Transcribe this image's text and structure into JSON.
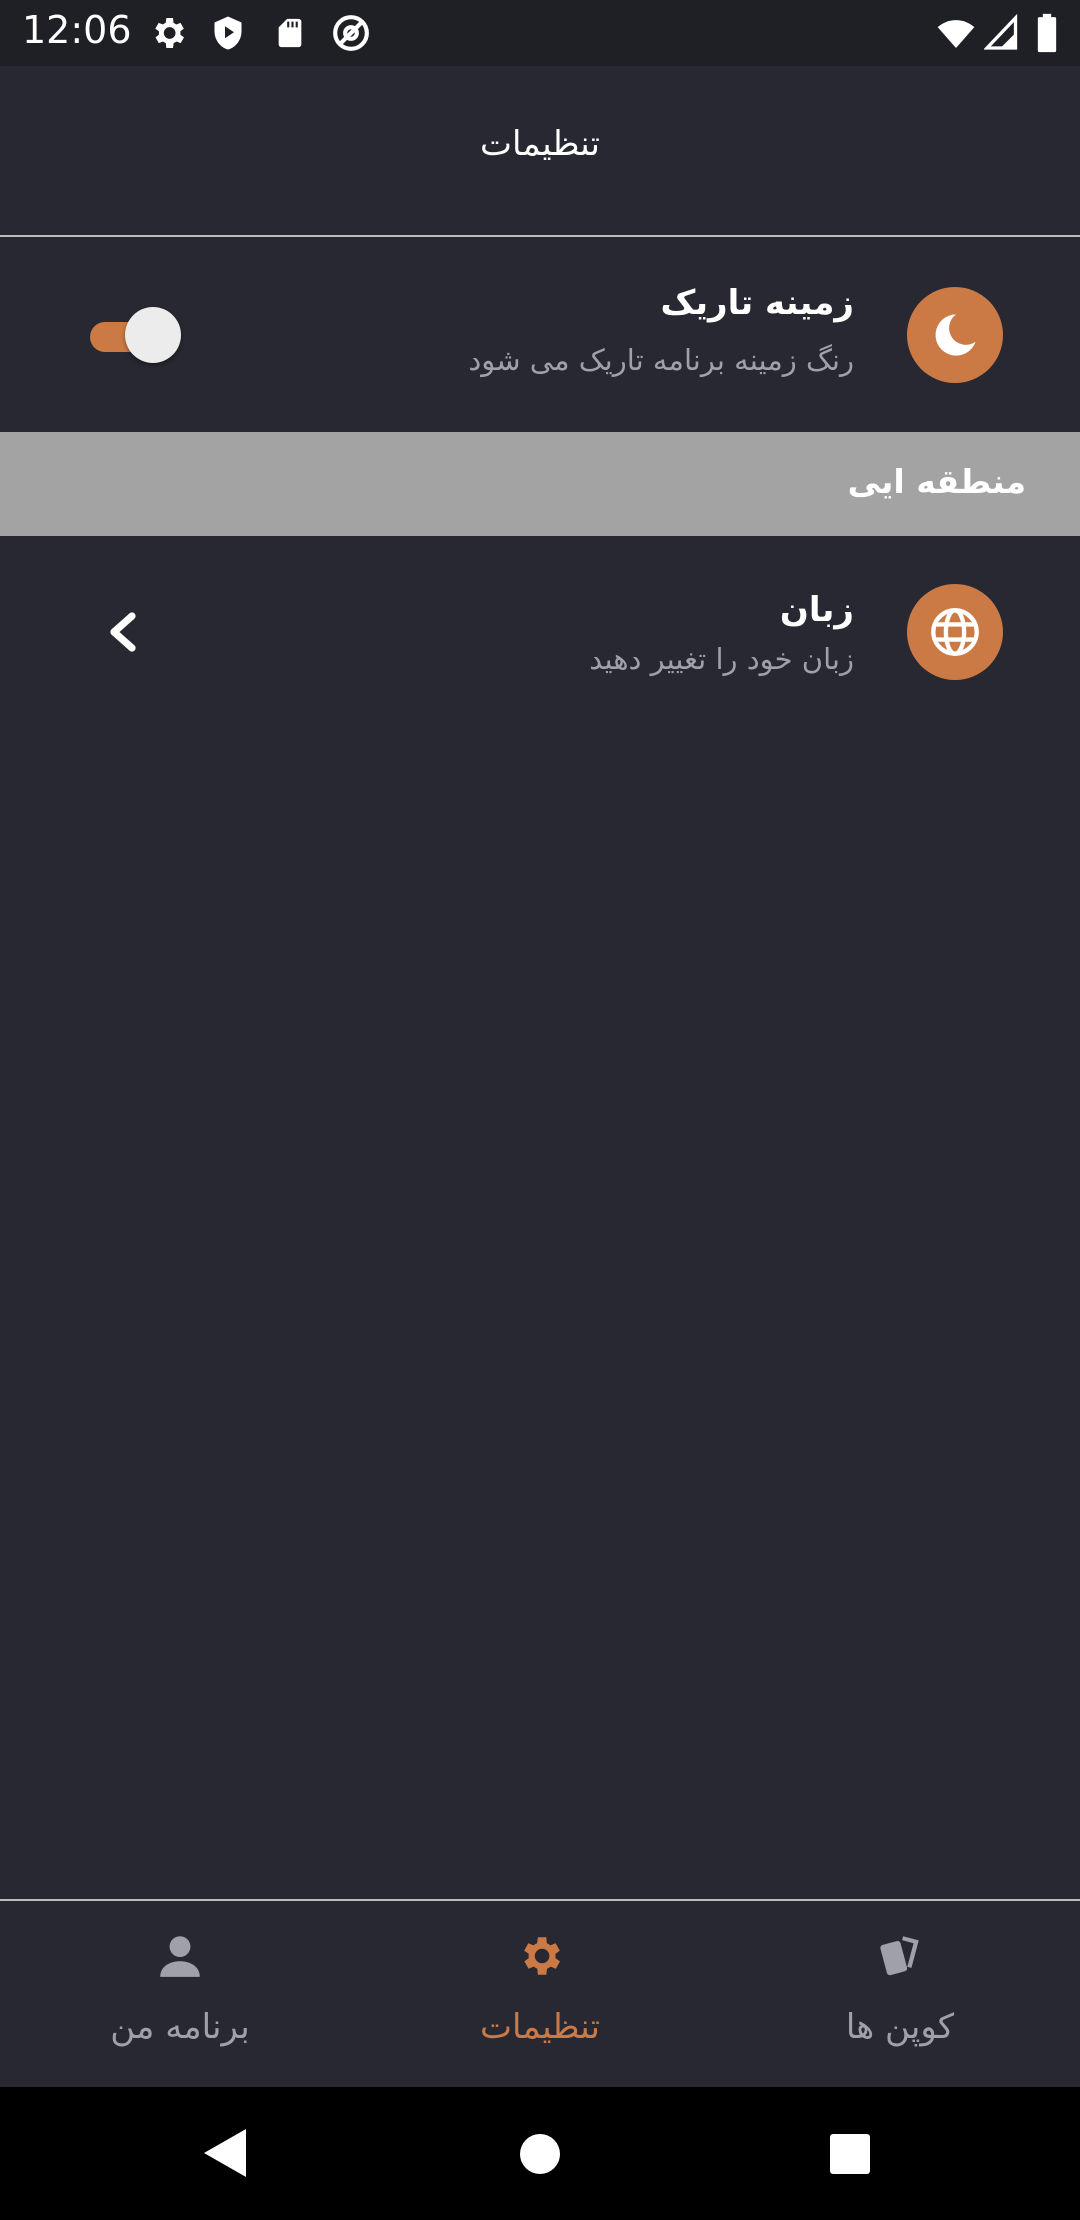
{
  "status_bar": {
    "time": "12:06",
    "icons": [
      "gear-icon",
      "shield-play-icon",
      "sd-card-icon",
      "at-sign-icon",
      "wifi-icon",
      "signal-icon",
      "battery-icon"
    ]
  },
  "app_bar": {
    "title": "تنظیمات"
  },
  "dark_mode": {
    "title": "زمینه تاریک",
    "subtitle": "رنگ زمینه برنامه تاریک می شود",
    "icon": "moon-icon",
    "enabled": true
  },
  "section": {
    "title": "منطقه ایی"
  },
  "language": {
    "title": "زبان",
    "subtitle": "زبان خود را تغییر دهید",
    "icon": "globe-icon"
  },
  "bottom_nav": {
    "items": [
      {
        "label": "برنامه من",
        "icon": "person-icon",
        "active": false
      },
      {
        "label": "تنظیمات",
        "icon": "gear-icon",
        "active": true
      },
      {
        "label": "کوپن ها",
        "icon": "coupons-icon",
        "active": false
      }
    ]
  },
  "colors": {
    "accent": "#cc7a45",
    "background": "#282832",
    "section_header": "#a3a3a3",
    "secondary_text": "#a0a0a8"
  }
}
